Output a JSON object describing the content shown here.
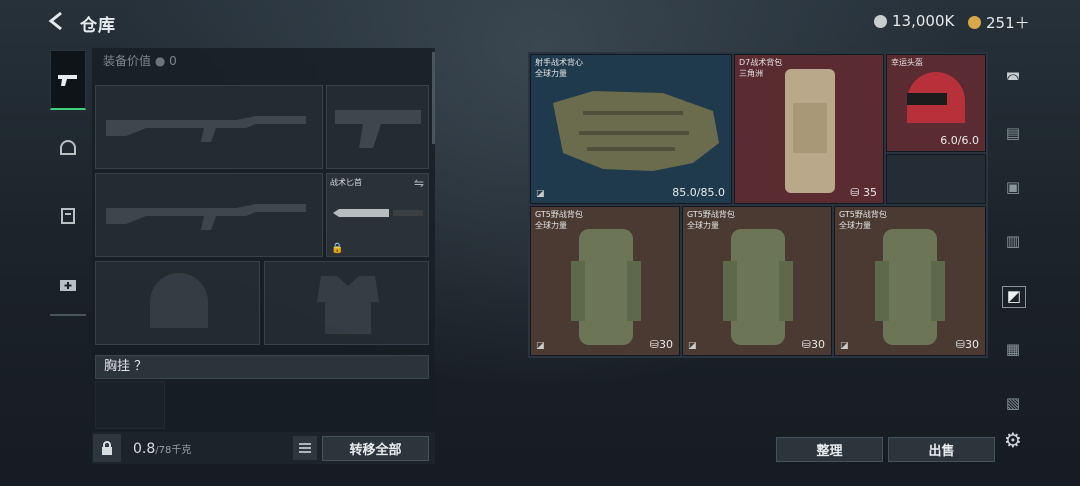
{
  "header": {
    "back_icon": "back-arrow-icon",
    "title": "仓库"
  },
  "currencies": [
    {
      "icon": "silver-coin-icon",
      "color": "#c8cdd0",
      "value": "13,000K"
    },
    {
      "icon": "gold-coin-icon",
      "color": "#d8a84a",
      "value": "251＋"
    }
  ],
  "tabs": [
    {
      "icon": "pistol-icon",
      "active": true
    },
    {
      "icon": "helmet-icon",
      "active": false
    },
    {
      "icon": "vest-icon",
      "active": false
    },
    {
      "icon": "medkit-icon",
      "active": false
    }
  ],
  "equipment": {
    "value_label": "装备价值",
    "value": "0",
    "knife_label": "战术匕首",
    "chest_label": "胸挂 ？"
  },
  "bottom": {
    "weight": "0.8",
    "weight_capacity": "/78千克",
    "transfer_all": "转移全部"
  },
  "inventory": [
    {
      "name": "射手战术背心",
      "sub": "全球力量",
      "value": "85.0/85.0",
      "bg": "#1f3a4c"
    },
    {
      "name": "D7战术背包",
      "sub": "三角洲",
      "value": "35",
      "bg": "#5a2b31"
    },
    {
      "name": "幸运头盔",
      "sub": "",
      "value": "6.0/6.0",
      "bg": "#5a2b31"
    },
    {
      "name": "GT5野战背包",
      "sub": "全球力量",
      "value": "30",
      "bg": "#4a3a31"
    },
    {
      "name": "GT5野战背包",
      "sub": "全球力量",
      "value": "30",
      "bg": "#4a3a31"
    },
    {
      "name": "GT5野战背包",
      "sub": "全球力量",
      "value": "30",
      "bg": "#4a3a31"
    }
  ],
  "actions": {
    "sort": "整理",
    "sell": "出售"
  },
  "side_icons": [
    "vault-icon",
    "rifle-filter-icon",
    "case-filter-icon",
    "gun-filter-icon",
    "box-filter-icon",
    "chip-filter-icon",
    "item-filter-icon",
    "settings-icon"
  ]
}
